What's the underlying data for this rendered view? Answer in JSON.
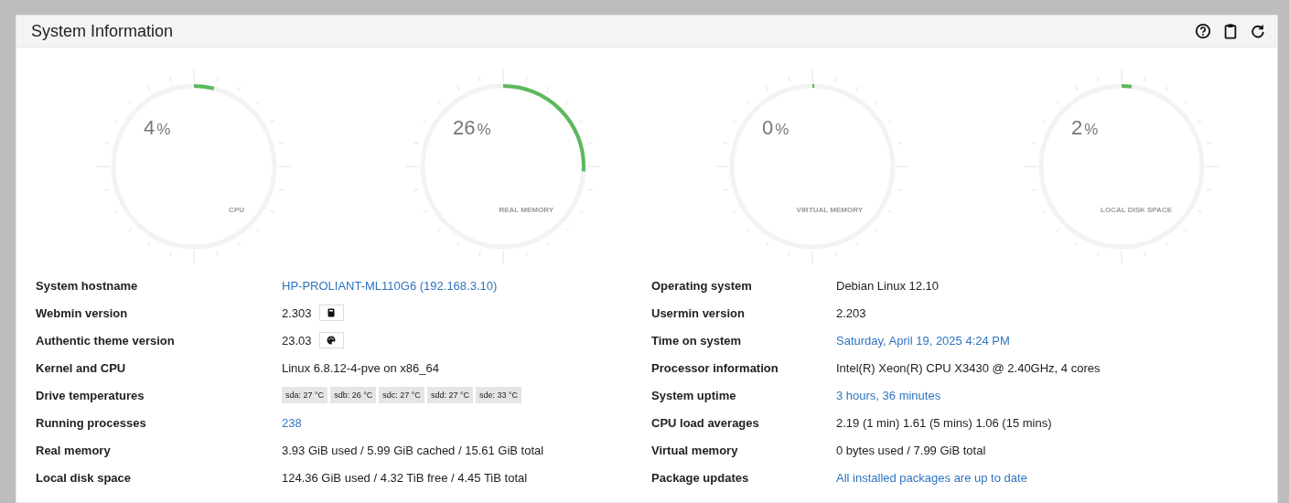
{
  "panel": {
    "title": "System Information"
  },
  "gauges": [
    {
      "value": "4",
      "unit": "%",
      "label": "CPU",
      "level": 0.04
    },
    {
      "value": "26",
      "unit": "%",
      "label": "REAL MEMORY",
      "level": 0.26
    },
    {
      "value": "0",
      "unit": "%",
      "label": "VIRTUAL MEMORY",
      "level": 0
    },
    {
      "value": "2",
      "unit": "%",
      "label": "LOCAL DISK SPACE",
      "level": 0.02
    }
  ],
  "rows": [
    [
      {
        "label": "System hostname",
        "kind": "link",
        "value": "HP-PROLIANT-ML110G6 (192.168.3.10)"
      },
      {
        "label": "Operating system",
        "kind": "text",
        "value": "Debian Linux 12.10"
      }
    ],
    [
      {
        "label": "Webmin version",
        "kind": "version",
        "value": "2.303"
      },
      {
        "label": "Usermin version",
        "kind": "text",
        "value": "2.203"
      }
    ],
    [
      {
        "label": "Authentic theme version",
        "kind": "version",
        "value": "23.03"
      },
      {
        "label": "Time on system",
        "kind": "link",
        "value": "Saturday, April 19, 2025 4:24 PM"
      }
    ],
    [
      {
        "label": "Kernel and CPU",
        "kind": "text",
        "value": "Linux 6.8.12-4-pve on x86_64"
      },
      {
        "label": "Processor information",
        "kind": "text",
        "value": "Intel(R) Xeon(R) CPU X3430 @ 2.40GHz, 4 cores"
      }
    ],
    [
      {
        "label": "Drive temperatures",
        "kind": "chips",
        "chips": [
          "sda: 27 °C",
          "sdb: 26 °C",
          "sdc: 27 °C",
          "sdd: 27 °C",
          "sde: 33 °C"
        ]
      },
      {
        "label": "System uptime",
        "kind": "link",
        "value": "3 hours, 36 minutes"
      }
    ],
    [
      {
        "label": "Running processes",
        "kind": "link",
        "value": "238"
      },
      {
        "label": "CPU load averages",
        "kind": "text",
        "value": "2.19 (1 min) 1.61 (5 mins) 1.06 (15 mins)"
      }
    ],
    [
      {
        "label": "Real memory",
        "kind": "text",
        "value": "3.93 GiB used / 5.99 GiB cached / 15.61 GiB total"
      },
      {
        "label": "Virtual memory",
        "kind": "text",
        "value": "0 bytes used / 7.99 GiB total"
      }
    ],
    [
      {
        "label": "Local disk space",
        "kind": "text",
        "value": "124.36 GiB used / 4.32 TiB free / 4.45 TiB total"
      },
      {
        "label": "Package updates",
        "kind": "link",
        "value": "All installed packages are up to date"
      }
    ]
  ]
}
